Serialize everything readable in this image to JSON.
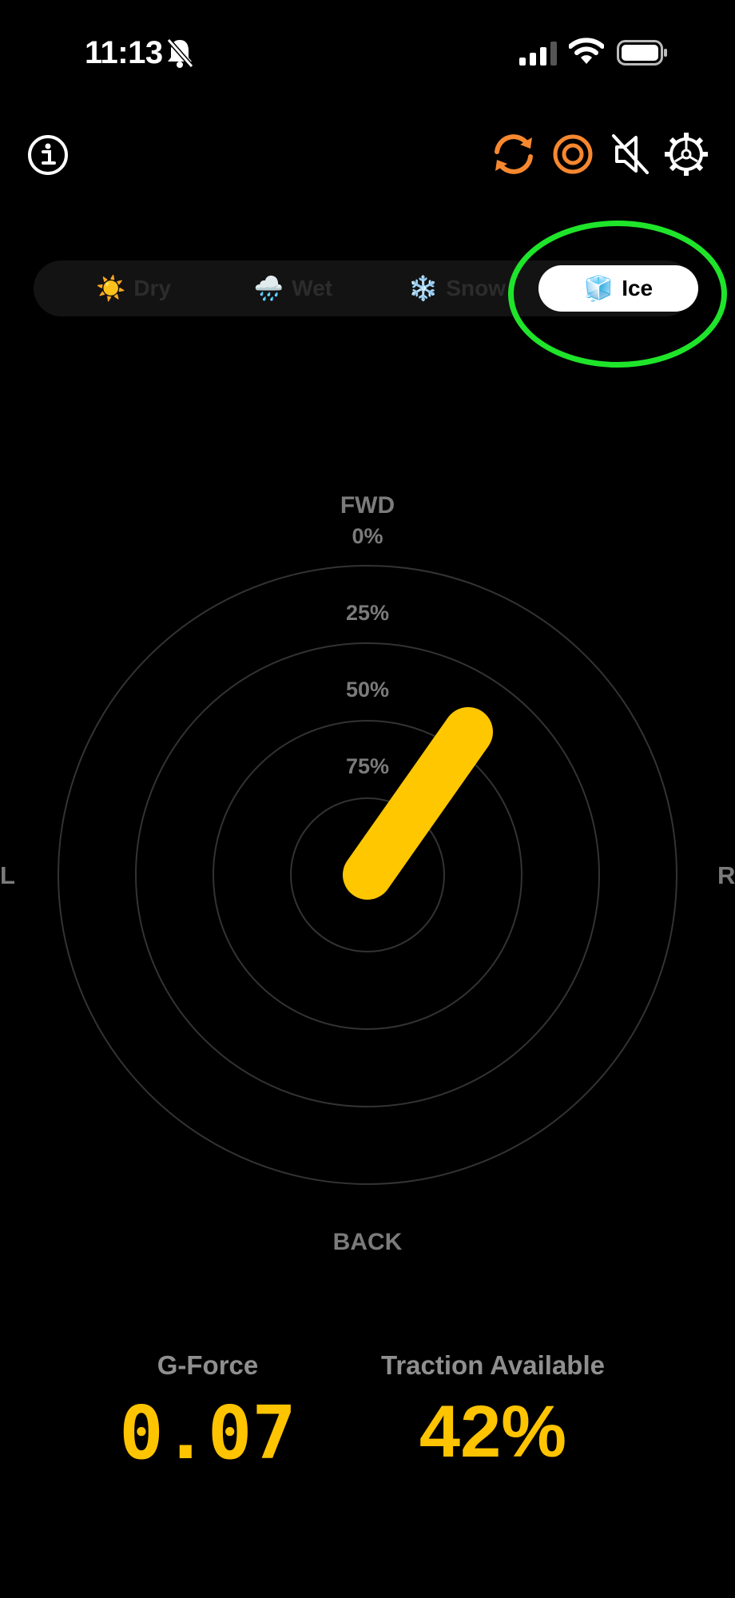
{
  "status_bar": {
    "time": "11:13",
    "icons": [
      "bell-slash-icon",
      "cellular-signal-icon",
      "wifi-icon",
      "battery-icon"
    ]
  },
  "toolbar": {
    "icons": [
      "info-icon",
      "sync-icon",
      "target-icon",
      "mute-icon",
      "settings-icon"
    ],
    "accent_color": "#f7882f"
  },
  "surfaces": {
    "options": [
      {
        "emoji": "☀️",
        "label": "Dry"
      },
      {
        "emoji": "🌧️",
        "label": "Wet"
      },
      {
        "emoji": "❄️",
        "label": "Snow"
      },
      {
        "emoji": "🧊",
        "label": "Ice"
      }
    ],
    "selected": "Ice",
    "highlight_color": "#1fe52a"
  },
  "gauge": {
    "top_label": "FWD",
    "ring_labels": [
      "0%",
      "25%",
      "50%",
      "75%"
    ],
    "left_label": "L",
    "right_label": "R",
    "bottom_label": "BACK",
    "needle_color": "#ffc700"
  },
  "readouts": {
    "gforce_label": "G-Force",
    "gforce_value": "0.07",
    "traction_label": "Traction Available",
    "traction_value": "42%"
  }
}
